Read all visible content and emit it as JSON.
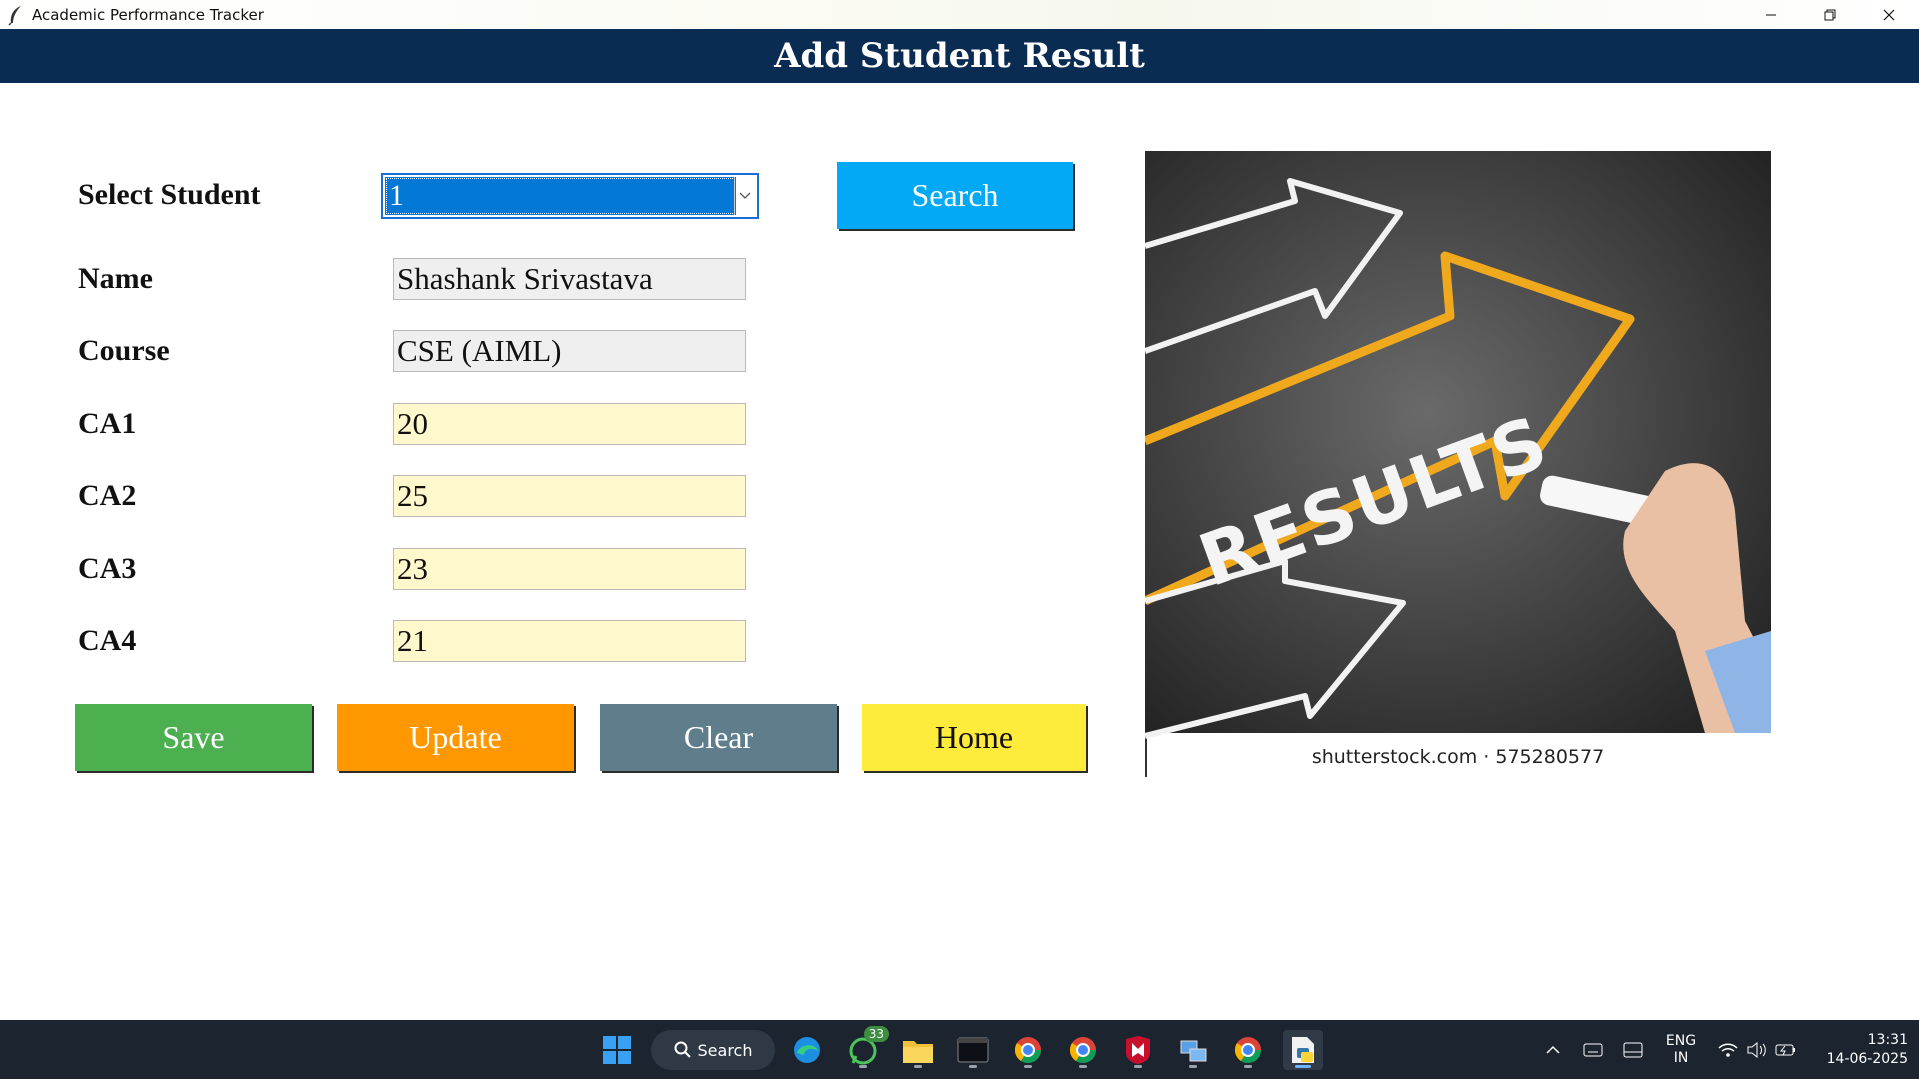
{
  "window": {
    "title": "Academic Performance Tracker"
  },
  "header": {
    "title": "Add Student Result"
  },
  "form": {
    "select_student": {
      "label": "Select Student",
      "selected": "1"
    },
    "search_button": "Search",
    "name": {
      "label": "Name",
      "value": "Shashank Srivastava"
    },
    "course": {
      "label": "Course",
      "value": "CSE (AIML)"
    },
    "ca1": {
      "label": "CA1",
      "value": "20"
    },
    "ca2": {
      "label": "CA2",
      "value": "25"
    },
    "ca3": {
      "label": "CA3",
      "value": "23"
    },
    "ca4": {
      "label": "CA4",
      "value": "21"
    }
  },
  "buttons": {
    "save": "Save",
    "update": "Update",
    "clear": "Clear",
    "home": "Home"
  },
  "image": {
    "word": "RESULTS",
    "caption": "shutterstock.com · 575280577"
  },
  "taskbar": {
    "search_label": "Search",
    "whatsapp_badge": "33",
    "language": "ENG",
    "region": "IN",
    "time": "13:31",
    "date": "14-06-2025"
  },
  "colors": {
    "header_bg": "#0b2c52",
    "search_btn": "#03a9f4",
    "save_btn": "#4caf50",
    "update_btn": "#ff9800",
    "clear_btn": "#607d8b",
    "home_btn": "#ffeb3b",
    "editable_field": "#fff8cc",
    "readonly_field": "#efefef",
    "combo_selected": "#0478d7"
  }
}
